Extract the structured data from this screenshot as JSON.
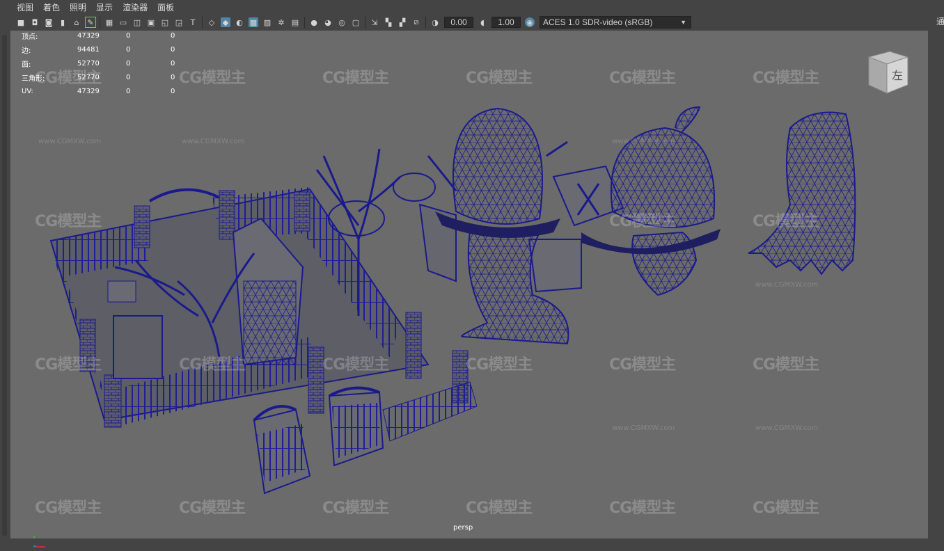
{
  "menu": {
    "items": [
      "视图",
      "着色",
      "照明",
      "显示",
      "渲染器",
      "面板"
    ]
  },
  "toolbar": {
    "exposure_value": "0.00",
    "gamma_value": "1.00",
    "color_space": "ACES 1.0 SDR-video (sRGB)",
    "icons": [
      "camera-icon",
      "camera-attr-icon",
      "bookmark-icon",
      "image-plane-icon",
      "grease-pencil-icon",
      "grid-icon",
      "film-gate-icon",
      "resolution-gate-icon",
      "gate-mask-icon",
      "field-chart-icon",
      "safe-action-icon",
      "safe-title-icon",
      "wireframe-icon",
      "smooth-shade-icon",
      "wireframe-on-shaded-icon",
      "textured-icon",
      "use-all-lights-icon",
      "shadows-icon",
      "ambient-occlusion-icon",
      "motion-blur-icon",
      "anti-aliasing-icon",
      "depth-of-field-icon",
      "xray-icon",
      "isolate-select-icon",
      "hud-icon",
      "xray-joints-icon",
      "xray-active-icon",
      "exposure-icon",
      "gamma-icon",
      "color-management-icon"
    ]
  },
  "stats": {
    "rows": [
      {
        "label": "顶点:",
        "value": "47329",
        "a": "0",
        "b": "0"
      },
      {
        "label": "边:",
        "value": "94481",
        "a": "0",
        "b": "0"
      },
      {
        "label": "面:",
        "value": "52770",
        "a": "0",
        "b": "0"
      },
      {
        "label": "三角形:",
        "value": "52770",
        "a": "0",
        "b": "0"
      },
      {
        "label": "UV:",
        "value": "47329",
        "a": "0",
        "b": "0"
      }
    ]
  },
  "viewport": {
    "camera_label": "persp",
    "viewcube_label": "左",
    "right_edge_label": "通"
  },
  "watermark": {
    "logo_text": "CG模型主",
    "url_text": "www.CGMXW.com"
  },
  "colors": {
    "viewport_bg": "#6b6b6b",
    "wire": "#1a1a8c",
    "ui_bg": "#444444",
    "accent": "#5285a6"
  }
}
